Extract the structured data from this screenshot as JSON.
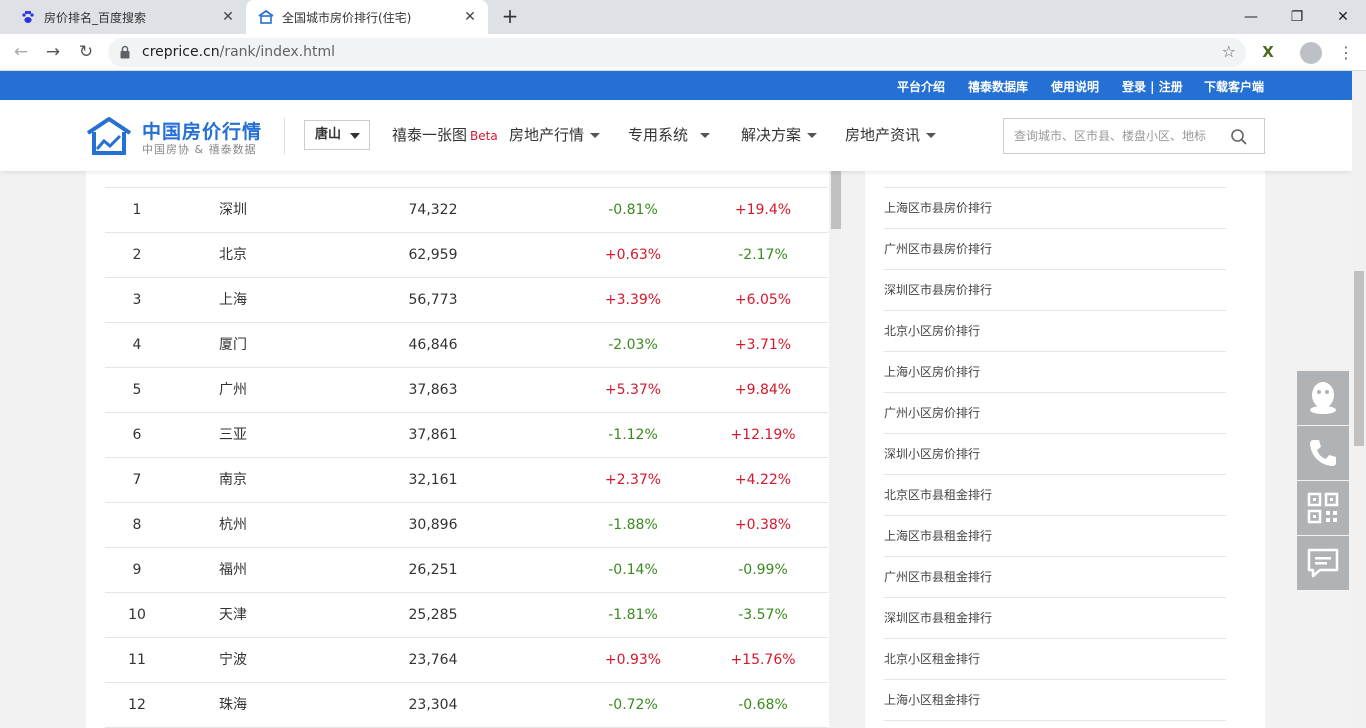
{
  "browser": {
    "tabs": [
      {
        "title": "房价排名_百度搜索",
        "favicon": "baidu-paw-icon"
      },
      {
        "title": "全国城市房价排行(住宅)",
        "favicon": "house-logo-icon",
        "active": true
      }
    ],
    "url_host": "creprice.cn",
    "url_path": "/rank/index.html"
  },
  "topbar": {
    "links": [
      "平台介绍",
      "禧泰数据库",
      "使用说明",
      "登录 | 注册",
      "下载客户端"
    ]
  },
  "header": {
    "brand": "中国房价行情",
    "brand_sub": "中国房协 & 禧泰数据",
    "city": "唐山",
    "nav": [
      {
        "label": "禧泰一张图",
        "badge": "Beta"
      },
      {
        "label": "房地产行情",
        "dropdown": true
      },
      {
        "label": "专用系统",
        "dropdown": true
      },
      {
        "label": "解决方案",
        "dropdown": true
      },
      {
        "label": "房地产资讯",
        "dropdown": true
      }
    ],
    "search_placeholder": "查询城市、区市县、楼盘小区、地标"
  },
  "ranking": {
    "rows": [
      {
        "rank": "1",
        "city": "深圳",
        "price": "74,322",
        "mom": "-0.81%",
        "yoy": "+19.4%"
      },
      {
        "rank": "2",
        "city": "北京",
        "price": "62,959",
        "mom": "+0.63%",
        "yoy": "-2.17%"
      },
      {
        "rank": "3",
        "city": "上海",
        "price": "56,773",
        "mom": "+3.39%",
        "yoy": "+6.05%"
      },
      {
        "rank": "4",
        "city": "厦门",
        "price": "46,846",
        "mom": "-2.03%",
        "yoy": "+3.71%"
      },
      {
        "rank": "5",
        "city": "广州",
        "price": "37,863",
        "mom": "+5.37%",
        "yoy": "+9.84%"
      },
      {
        "rank": "6",
        "city": "三亚",
        "price": "37,861",
        "mom": "-1.12%",
        "yoy": "+12.19%"
      },
      {
        "rank": "7",
        "city": "南京",
        "price": "32,161",
        "mom": "+2.37%",
        "yoy": "+4.22%"
      },
      {
        "rank": "8",
        "city": "杭州",
        "price": "30,896",
        "mom": "-1.88%",
        "yoy": "+0.38%"
      },
      {
        "rank": "9",
        "city": "福州",
        "price": "26,251",
        "mom": "-0.14%",
        "yoy": "-0.99%"
      },
      {
        "rank": "10",
        "city": "天津",
        "price": "25,285",
        "mom": "-1.81%",
        "yoy": "-3.57%"
      },
      {
        "rank": "11",
        "city": "宁波",
        "price": "23,764",
        "mom": "+0.93%",
        "yoy": "+15.76%"
      },
      {
        "rank": "12",
        "city": "珠海",
        "price": "23,304",
        "mom": "-0.72%",
        "yoy": "-0.68%"
      }
    ]
  },
  "sidebar_links": [
    "上海区市县房价排行",
    "广州区市县房价排行",
    "深圳区市县房价排行",
    "北京小区房价排行",
    "上海小区房价排行",
    "广州小区房价排行",
    "深圳小区房价排行",
    "北京区市县租金排行",
    "上海区市县租金排行",
    "广州区市县租金排行",
    "深圳区市县租金排行",
    "北京小区租金排行",
    "上海小区租金排行"
  ],
  "side_tools": [
    "qq-icon",
    "phone-icon",
    "qrcode-icon",
    "message-icon"
  ],
  "colors": {
    "brand_blue": "#2470d4",
    "up": "#d6182c",
    "down": "#3a8a1f"
  }
}
